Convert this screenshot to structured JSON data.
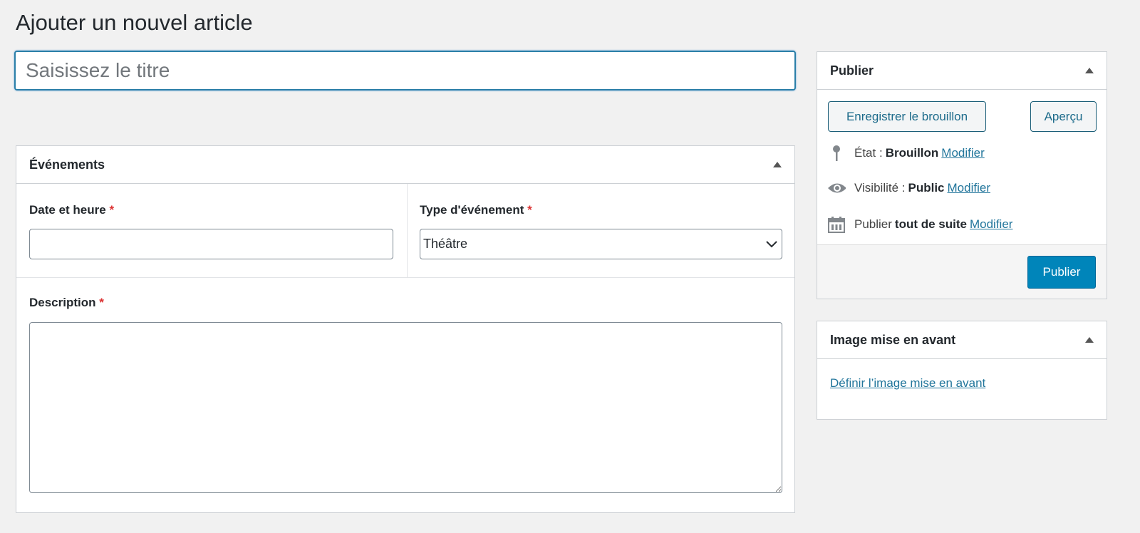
{
  "page_title": "Ajouter un nouvel article",
  "title_placeholder": "Saisissez le titre",
  "events": {
    "heading": "Événements",
    "date_label": "Date et heure",
    "date_value": "",
    "type_label": "Type d'événement",
    "type_value": "Théâtre",
    "description_label": "Description",
    "description_value": "",
    "required_mark": "*"
  },
  "publish": {
    "heading": "Publier",
    "save_draft": "Enregistrer le brouillon",
    "preview": "Aperçu",
    "status_label": "État :",
    "status_value": "Brouillon",
    "visibility_label": "Visibilité :",
    "visibility_value": "Public",
    "schedule_label": "Publier",
    "schedule_value": "tout de suite",
    "modify": "Modifier",
    "publish_button": "Publier",
    "accent": "#0085ba"
  },
  "featured_image": {
    "heading": "Image mise en avant",
    "link": "Définir l’image mise en avant"
  }
}
